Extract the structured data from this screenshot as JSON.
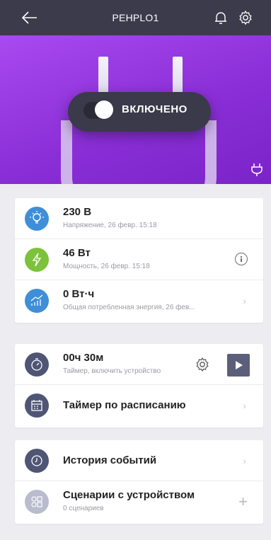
{
  "header": {
    "title": "PEHPLO1",
    "back_icon": "arrow-left-icon",
    "bell_icon": "bell-icon",
    "settings_icon": "gear-icon"
  },
  "hero": {
    "state_label": "ВКЛЮЧЕНО",
    "toggle_on": true
  },
  "metrics": [
    {
      "value": "230 В",
      "caption": "Напряжение, 26 февр. 15:18",
      "icon": "bulb-icon",
      "color": "#3e8ed8"
    },
    {
      "value": "46 Вт",
      "caption": "Мощность, 26 февр. 15:18",
      "icon": "lightning-icon",
      "color": "#7cc23a"
    },
    {
      "value": "0 Вт·ч",
      "caption": "Общая потребленная энергия, 26 фев...",
      "icon": "energy-chart-icon",
      "color": "#3e8ed8"
    }
  ],
  "timer": {
    "value": "00ч 30м",
    "caption": "Таймер, включить устройство"
  },
  "schedule": {
    "label": "Таймер по расписанию"
  },
  "history": {
    "label": "История событий"
  },
  "scenarios": {
    "label": "Сценарии с устройством",
    "caption": "0 сценариев"
  }
}
